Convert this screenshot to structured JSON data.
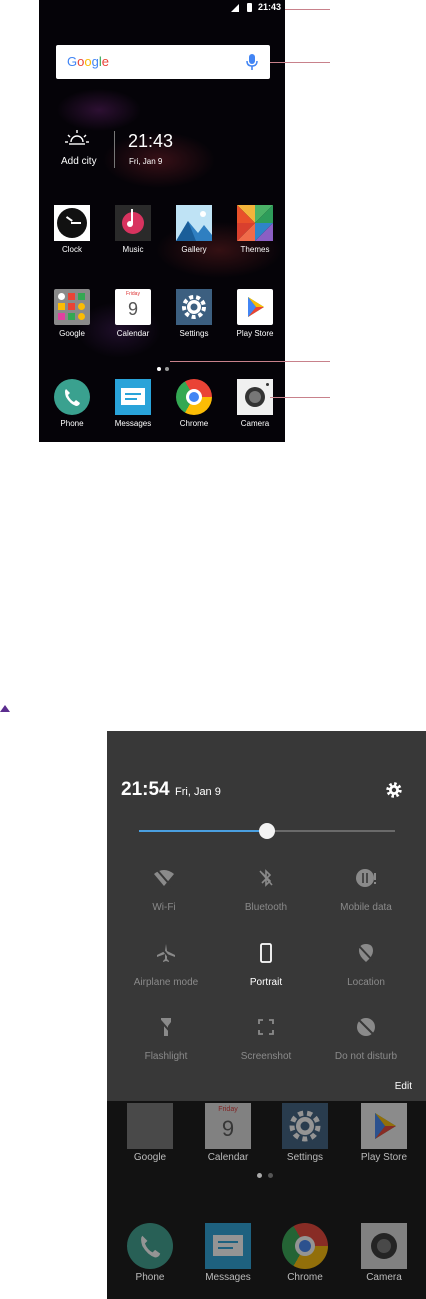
{
  "home": {
    "status_time": "21:43",
    "search_logo": "Google",
    "add_city": "Add city",
    "clock_time": "21:43",
    "clock_date": "Fri, Jan 9",
    "apps": [
      {
        "label": "Clock",
        "icon": "clock-icon"
      },
      {
        "label": "Music",
        "icon": "music-icon"
      },
      {
        "label": "Gallery",
        "icon": "gallery-icon"
      },
      {
        "label": "Themes",
        "icon": "themes-icon"
      },
      {
        "label": "Google",
        "icon": "google-folder-icon"
      },
      {
        "label": "Calendar",
        "icon": "calendar-icon"
      },
      {
        "label": "Settings",
        "icon": "settings-icon"
      },
      {
        "label": "Play Store",
        "icon": "play-store-icon"
      }
    ],
    "calendar_day": "Friday",
    "calendar_num": "9",
    "dock": [
      {
        "label": "Phone",
        "icon": "phone-icon"
      },
      {
        "label": "Messages",
        "icon": "messages-icon"
      },
      {
        "label": "Chrome",
        "icon": "chrome-icon"
      },
      {
        "label": "Camera",
        "icon": "camera-icon"
      }
    ]
  },
  "quick_settings": {
    "time": "21:54",
    "date": "Fri, Jan 9",
    "brightness": 0.5,
    "tiles": [
      {
        "label": "Wi-Fi",
        "icon": "wifi-off-icon",
        "active": false
      },
      {
        "label": "Bluetooth",
        "icon": "bluetooth-off-icon",
        "active": false
      },
      {
        "label": "Mobile data",
        "icon": "mobile-data-icon",
        "active": false
      },
      {
        "label": "Airplane mode",
        "icon": "airplane-icon",
        "active": false
      },
      {
        "label": "Portrait",
        "icon": "portrait-icon",
        "active": true
      },
      {
        "label": "Location",
        "icon": "location-off-icon",
        "active": false
      },
      {
        "label": "Flashlight",
        "icon": "flashlight-icon",
        "active": false
      },
      {
        "label": "Screenshot",
        "icon": "screenshot-icon",
        "active": false
      },
      {
        "label": "Do not disturb",
        "icon": "do-not-disturb-icon",
        "active": false
      }
    ],
    "edit_label": "Edit",
    "background_apps": [
      "Google",
      "Calendar",
      "Settings",
      "Play Store"
    ],
    "background_dock": [
      "Phone",
      "Messages",
      "Chrome",
      "Camera"
    ],
    "calendar_day": "Friday",
    "calendar_num": "9"
  },
  "colors": {
    "accent": "#4a9fe0",
    "callout": "#c8818b",
    "marker": "#5b2d8e"
  }
}
